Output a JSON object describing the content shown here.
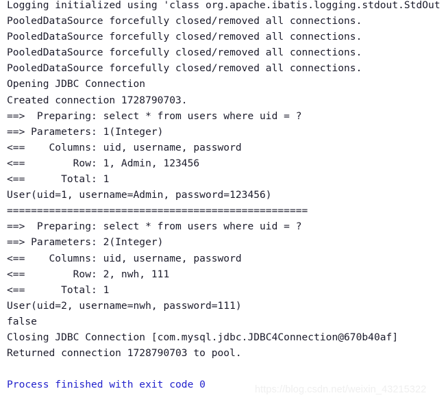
{
  "console": {
    "title": "IntelliJ IDEA Run console output",
    "background_color": "#ffffff",
    "text_color": "#1b1b2b",
    "accent_color": "#2222cc",
    "watermark_color": "#efefef",
    "lines": [
      {
        "id": "line-01",
        "text": "Logging initialized using 'class org.apache.ibatis.logging.stdout.StdOut",
        "style": "normal"
      },
      {
        "id": "line-02",
        "text": "PooledDataSource forcefully closed/removed all connections.",
        "style": "normal"
      },
      {
        "id": "line-03",
        "text": "PooledDataSource forcefully closed/removed all connections.",
        "style": "normal"
      },
      {
        "id": "line-04",
        "text": "PooledDataSource forcefully closed/removed all connections.",
        "style": "normal"
      },
      {
        "id": "line-05",
        "text": "PooledDataSource forcefully closed/removed all connections.",
        "style": "normal"
      },
      {
        "id": "line-06",
        "text": "Opening JDBC Connection",
        "style": "normal"
      },
      {
        "id": "line-07",
        "text": "Created connection 1728790703.",
        "style": "normal"
      },
      {
        "id": "line-08",
        "text": "==>  Preparing: select * from users where uid = ?",
        "style": "normal"
      },
      {
        "id": "line-09",
        "text": "==> Parameters: 1(Integer)",
        "style": "normal"
      },
      {
        "id": "line-10",
        "text": "<==    Columns: uid, username, password",
        "style": "normal"
      },
      {
        "id": "line-11",
        "text": "<==        Row: 1, Admin, 123456",
        "style": "normal"
      },
      {
        "id": "line-12",
        "text": "<==      Total: 1",
        "style": "normal"
      },
      {
        "id": "line-13",
        "text": "User(uid=1, username=Admin, password=123456)",
        "style": "normal"
      },
      {
        "id": "line-14",
        "text": "==================================================",
        "style": "normal"
      },
      {
        "id": "line-15",
        "text": "==>  Preparing: select * from users where uid = ?",
        "style": "normal"
      },
      {
        "id": "line-16",
        "text": "==> Parameters: 2(Integer)",
        "style": "normal"
      },
      {
        "id": "line-17",
        "text": "<==    Columns: uid, username, password",
        "style": "normal"
      },
      {
        "id": "line-18",
        "text": "<==        Row: 2, nwh, 111",
        "style": "normal"
      },
      {
        "id": "line-19",
        "text": "<==      Total: 1",
        "style": "normal"
      },
      {
        "id": "line-20",
        "text": "User(uid=2, username=nwh, password=111)",
        "style": "normal"
      },
      {
        "id": "line-21",
        "text": "false",
        "style": "normal"
      },
      {
        "id": "line-22",
        "text": "Closing JDBC Connection [com.mysql.jdbc.JDBC4Connection@670b40af]",
        "style": "normal"
      },
      {
        "id": "line-23",
        "text": "Returned connection 1728790703 to pool.",
        "style": "normal"
      },
      {
        "id": "line-24",
        "text": "",
        "style": "blank"
      },
      {
        "id": "line-25",
        "text": "Process finished with exit code 0",
        "style": "process-finished"
      }
    ]
  },
  "watermark": {
    "text": "https://blog.csdn.net/weixin_43215322"
  }
}
